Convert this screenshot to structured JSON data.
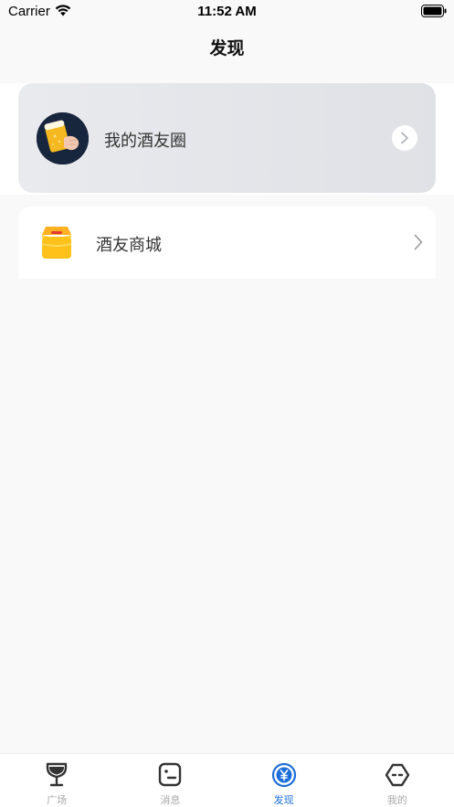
{
  "status_bar": {
    "carrier": "Carrier",
    "time": "11:52 AM"
  },
  "nav": {
    "title": "发现"
  },
  "cards": {
    "moments": {
      "label": "我的酒友圈",
      "icon": "beer-mug-avatar"
    },
    "mall": {
      "label": "酒友商城",
      "icon": "shop-icon"
    }
  },
  "tabbar": {
    "active_color": "#1e6fd9",
    "inactive_color": "#a8a8a8",
    "items": [
      {
        "label": "广场",
        "icon": "wine-glass-icon",
        "active": false
      },
      {
        "label": "消息",
        "icon": "message-icon",
        "active": false
      },
      {
        "label": "发现",
        "icon": "discover-yen-icon",
        "active": true
      },
      {
        "label": "我的",
        "icon": "profile-face-icon",
        "active": false
      }
    ]
  }
}
